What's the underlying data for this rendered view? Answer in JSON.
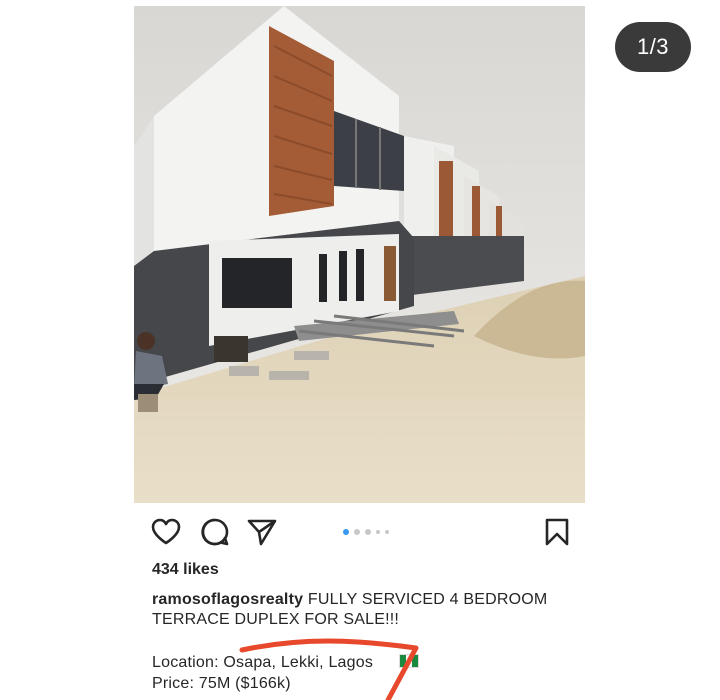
{
  "carousel": {
    "counter": "1/3",
    "active_index": 0,
    "total_dots": 5
  },
  "post": {
    "likes": "434 likes",
    "caption": {
      "username": "ramosoflagosrealty",
      "text": "FULLY SERVICED 4 BEDROOM TERRACE DUPLEX FOR SALE!!!"
    },
    "location": "Location: Osapa, Lekki, Lagos",
    "price": "Price: 75M ($166k)"
  },
  "icons": {
    "like": "heart-icon",
    "comment": "comment-icon",
    "share": "send-icon",
    "save": "bookmark-icon",
    "flag": "nigeria-flag-icon"
  },
  "colors": {
    "accent_dot": "#3897f0",
    "annotation": "#e8482b",
    "counter_bg": "#3a3a3a"
  }
}
